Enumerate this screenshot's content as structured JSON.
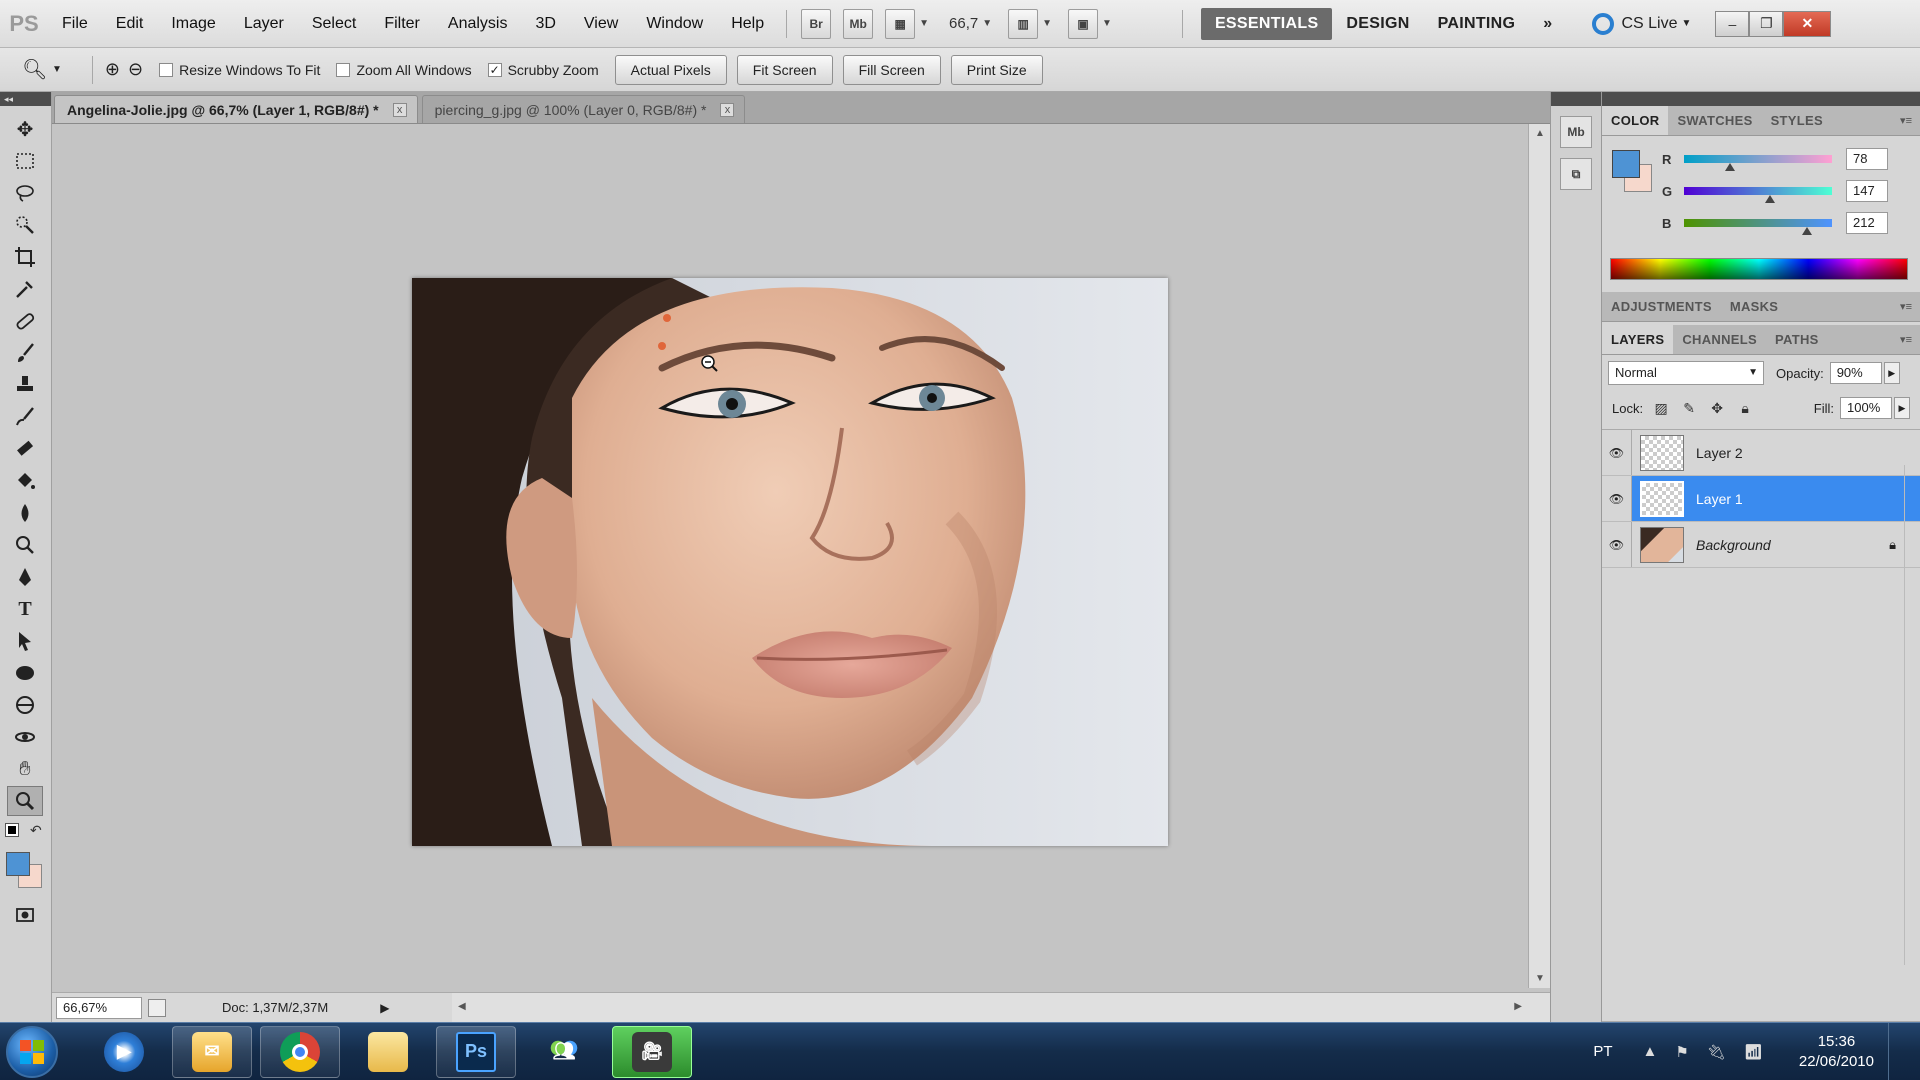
{
  "app": {
    "logo": "PS",
    "menu": [
      "File",
      "Edit",
      "Image",
      "Layer",
      "Select",
      "Filter",
      "Analysis",
      "3D",
      "View",
      "Window",
      "Help"
    ],
    "bridge_label": "Br",
    "minibridge_label": "Mb",
    "zoom": "66,7",
    "workspaces": [
      "ESSENTIALS",
      "DESIGN",
      "PAINTING"
    ],
    "more_workspaces": "»",
    "cslive": "CS Live"
  },
  "options": {
    "resize_windows": "Resize Windows To Fit",
    "zoom_all": "Zoom All Windows",
    "scrubby": "Scrubby Zoom",
    "scrubby_checked": "✓",
    "buttons": [
      "Actual Pixels",
      "Fit Screen",
      "Fill Screen",
      "Print Size"
    ]
  },
  "tabs": [
    {
      "label": "Angelina-Jolie.jpg @ 66,7% (Layer 1, RGB/8#) *",
      "active": true
    },
    {
      "label": "piercing_g.jpg @ 100% (Layer 0, RGB/8#) *",
      "active": false
    }
  ],
  "tab_close": "x",
  "status": {
    "zoom": "66,67%",
    "doc": "Doc: 1,37M/2,37M"
  },
  "color_panel": {
    "tabs": [
      "COLOR",
      "SWATCHES",
      "STYLES"
    ],
    "channels": [
      {
        "label": "R",
        "value": "78",
        "track": "linear-gradient(to right,#00a0c8,#ffa0d2)"
      },
      {
        "label": "G",
        "value": "147",
        "track": "linear-gradient(to right,#5000d4,#4effd4)"
      },
      {
        "label": "B",
        "value": "212",
        "track": "linear-gradient(to right,#4e9300,#4e93ff)"
      }
    ],
    "fg_color": "#4e93d4",
    "bg_color": "#f6d8cc"
  },
  "adjust_tabs": [
    "ADJUSTMENTS",
    "MASKS"
  ],
  "layers_panel": {
    "tabs": [
      "LAYERS",
      "CHANNELS",
      "PATHS"
    ],
    "blend_mode": "Normal",
    "opacity_label": "Opacity:",
    "opacity": "90%",
    "lock_label": "Lock:",
    "fill_label": "Fill:",
    "fill": "100%",
    "layers": [
      {
        "name": "Layer 2",
        "selected": false,
        "locked": false
      },
      {
        "name": "Layer 1",
        "selected": true,
        "locked": false
      },
      {
        "name": "Background",
        "selected": false,
        "locked": true
      }
    ]
  },
  "taskbar": {
    "apps": [
      "windows-media-player",
      "windows-live-mail",
      "google-chrome",
      "file-explorer",
      "photoshop",
      "windows-live-messenger",
      "video-recorder"
    ],
    "ps_label": "Ps",
    "lang": "PT",
    "time": "15:36",
    "date": "22/06/2010"
  }
}
